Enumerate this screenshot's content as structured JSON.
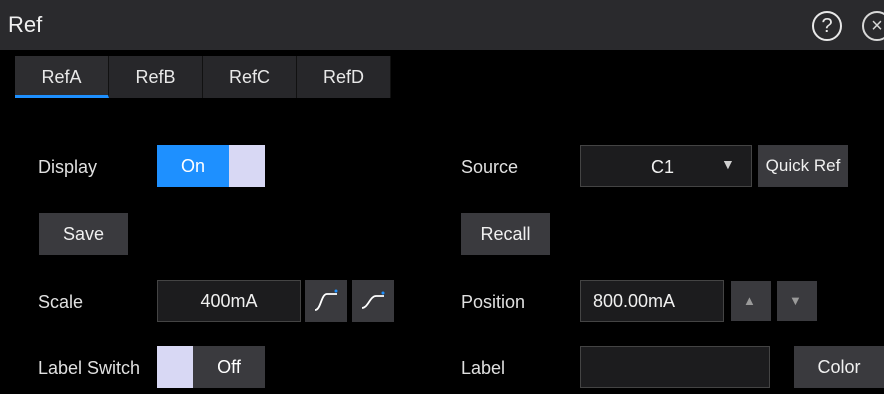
{
  "window": {
    "title": "Ref"
  },
  "tabs": [
    {
      "label": "RefA",
      "active": true
    },
    {
      "label": "RefB",
      "active": false
    },
    {
      "label": "RefC",
      "active": false
    },
    {
      "label": "RefD",
      "active": false
    }
  ],
  "display": {
    "label": "Display",
    "state": "On"
  },
  "source": {
    "label": "Source",
    "value": "C1",
    "quick_ref": "Quick Ref"
  },
  "actions": {
    "save": "Save",
    "recall": "Recall"
  },
  "scale": {
    "label": "Scale",
    "value": "400mA"
  },
  "position": {
    "label": "Position",
    "value": "800.00mA"
  },
  "label_switch": {
    "label": "Label Switch",
    "state": "Off"
  },
  "label_field": {
    "label": "Label",
    "value": "",
    "color_button": "Color"
  },
  "colors": {
    "accent": "#1e90ff",
    "toggle_knob": "#d8d8f4",
    "panel": "#2a2a2d",
    "button": "#3a3a3e"
  },
  "icons": [
    "help-icon",
    "close-icon",
    "dropdown-arrow-icon",
    "coarse-knob-icon",
    "fine-knob-icon",
    "arrow-up-icon",
    "arrow-down-icon"
  ]
}
